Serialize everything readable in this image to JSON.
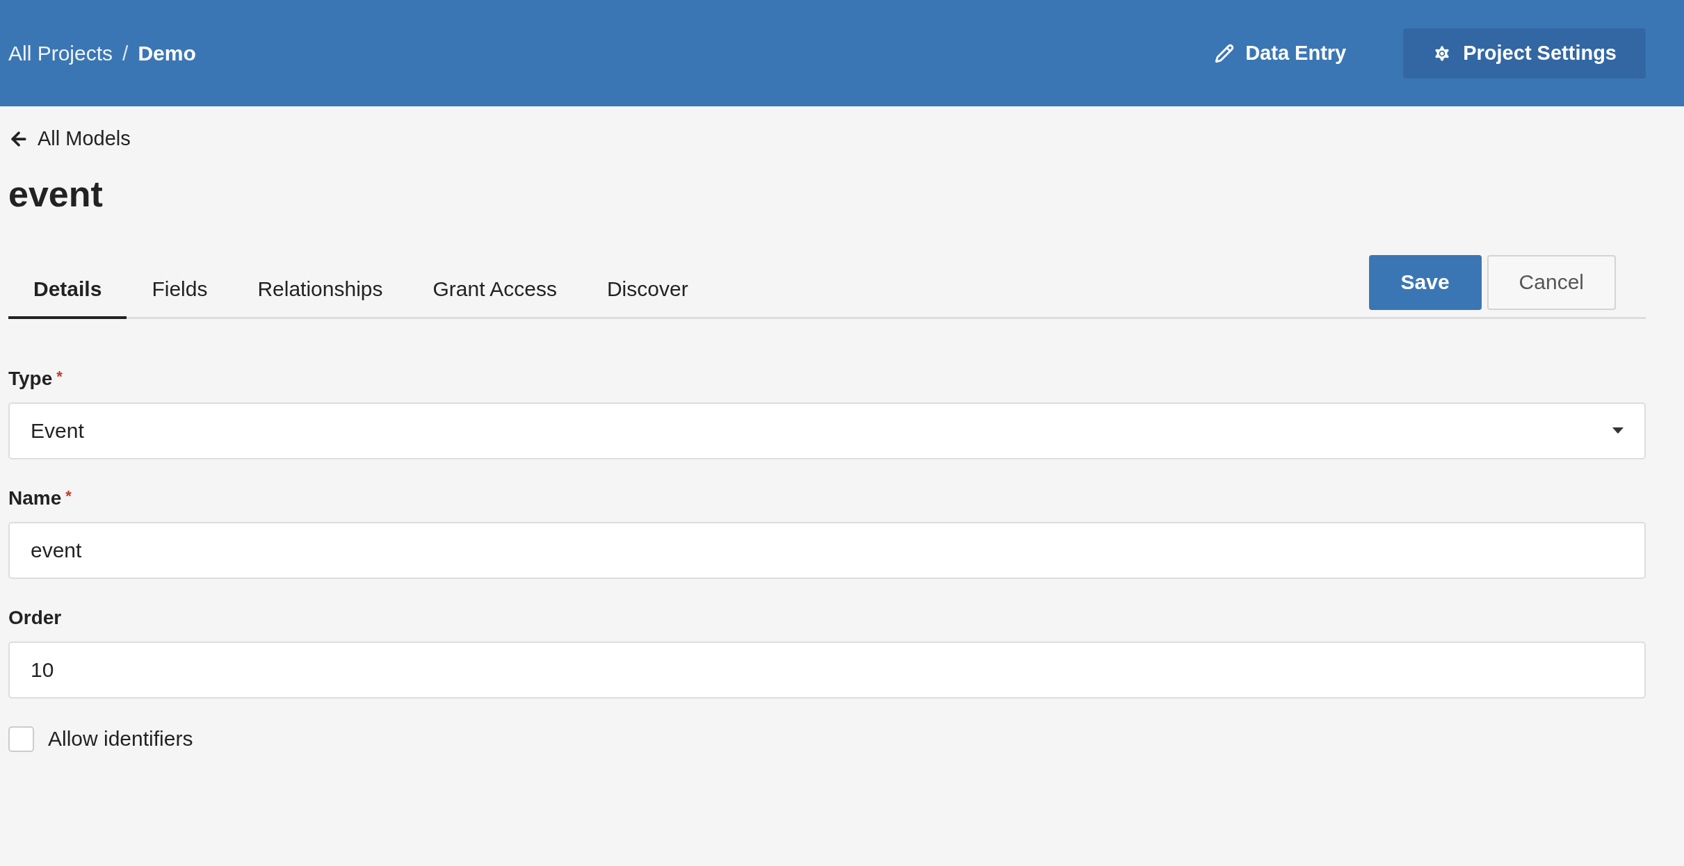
{
  "breadcrumb": {
    "separator": "/",
    "items": [
      {
        "label": "All Projects",
        "current": false
      },
      {
        "label": "Demo",
        "current": true
      }
    ]
  },
  "nav": [
    {
      "label": "Data Entry",
      "selected": false,
      "kind": "pencil"
    },
    {
      "label": "Project Settings",
      "selected": true,
      "kind": "gear"
    }
  ],
  "back_link": "All Models",
  "title": "event",
  "tabs": [
    {
      "label": "Details",
      "selected": true
    },
    {
      "label": "Fields",
      "selected": false
    },
    {
      "label": "Relationships",
      "selected": false
    },
    {
      "label": "Grant Access",
      "selected": false
    },
    {
      "label": "Discover",
      "selected": false
    }
  ],
  "actions": [
    {
      "label": "Save",
      "kind": "primary"
    },
    {
      "label": "Cancel",
      "kind": "secondary"
    }
  ],
  "fields": [
    {
      "kind": "select",
      "label": "Type",
      "required_mark": "*",
      "value": "Event"
    },
    {
      "kind": "text",
      "label": "Name",
      "required_mark": "*",
      "value": "event"
    },
    {
      "kind": "text",
      "label": "Order",
      "value": "10"
    }
  ],
  "checkbox": {
    "label": "Allow identifiers",
    "checked": false
  }
}
